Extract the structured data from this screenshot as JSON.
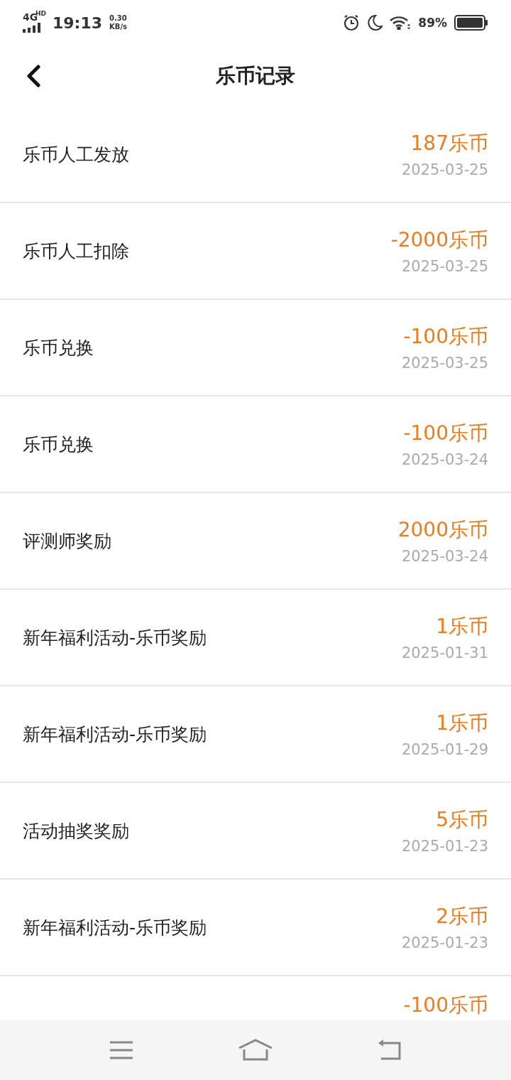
{
  "status_bar": {
    "network": "4G",
    "network_badge": "HD",
    "time": "19:13",
    "speed_value": "0.30",
    "speed_unit": "KB/s",
    "battery": "89%"
  },
  "header": {
    "title": "乐币记录"
  },
  "records": [
    {
      "title": "乐币人工发放",
      "amount": "187乐币",
      "date": "2025-03-25"
    },
    {
      "title": "乐币人工扣除",
      "amount": "-2000乐币",
      "date": "2025-03-25"
    },
    {
      "title": "乐币兑换",
      "amount": "-100乐币",
      "date": "2025-03-25"
    },
    {
      "title": "乐币兑换",
      "amount": "-100乐币",
      "date": "2025-03-24"
    },
    {
      "title": "评测师奖励",
      "amount": "2000乐币",
      "date": "2025-03-24"
    },
    {
      "title": "新年福利活动-乐币奖励",
      "amount": "1乐币",
      "date": "2025-01-31"
    },
    {
      "title": "新年福利活动-乐币奖励",
      "amount": "1乐币",
      "date": "2025-01-29"
    },
    {
      "title": "活动抽奖奖励",
      "amount": "5乐币",
      "date": "2025-01-23"
    },
    {
      "title": "新年福利活动-乐币奖励",
      "amount": "2乐币",
      "date": "2025-01-23"
    },
    {
      "amount": "-100乐币"
    }
  ]
}
